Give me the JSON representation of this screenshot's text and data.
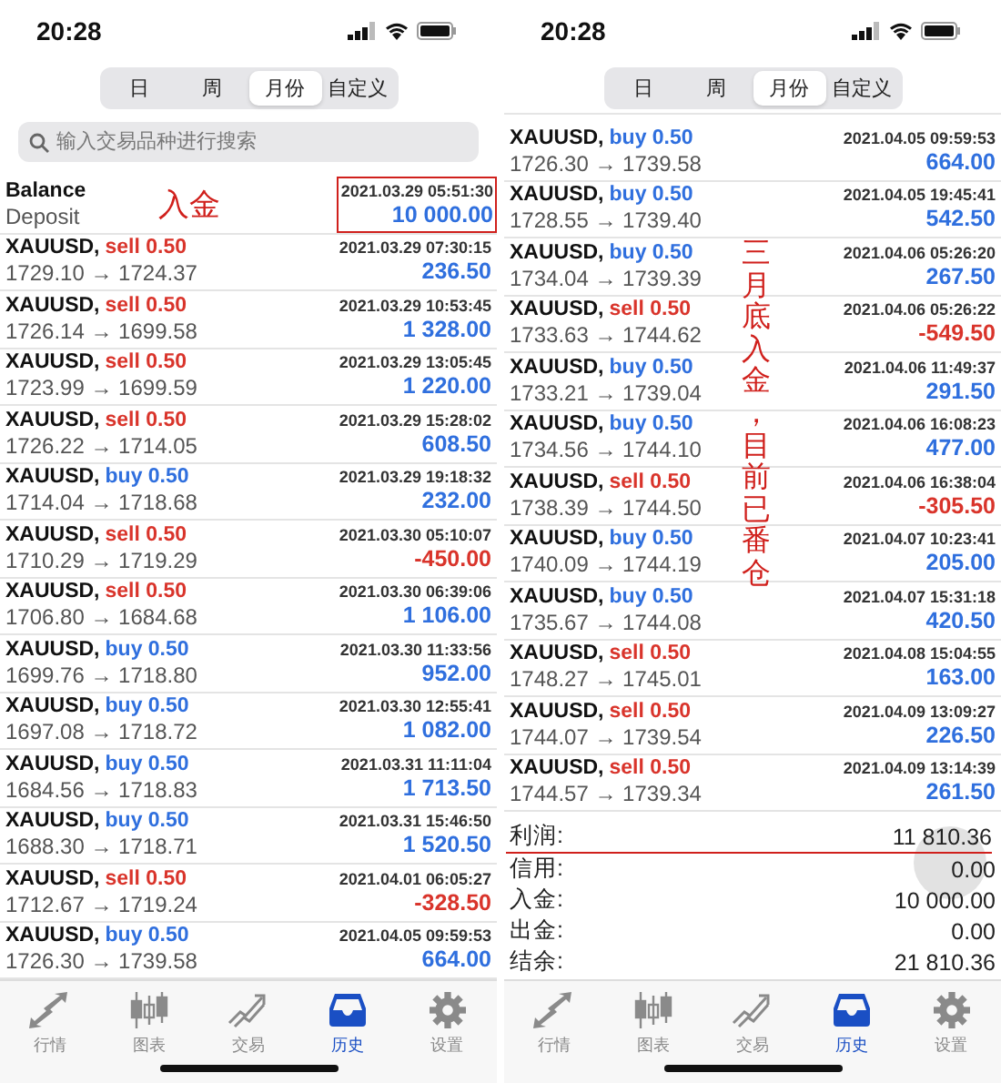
{
  "screens": [
    {
      "status_bar": {
        "time": "20:28"
      },
      "segments": [
        {
          "label": "日",
          "selected": false
        },
        {
          "label": "周",
          "selected": false
        },
        {
          "label": "月份",
          "selected": true
        },
        {
          "label": "自定义",
          "selected": false
        }
      ],
      "search": {
        "placeholder": "输入交易品种进行搜索"
      },
      "entries": [
        {
          "kind": "balance",
          "title": "Balance",
          "subtitle": "Deposit",
          "time": "2021.03.29 05:51:30",
          "amount": "10 000.00",
          "loss": false,
          "highlighted": true,
          "annotation": "入金"
        },
        {
          "kind": "trade",
          "symbol": "XAUUSD,",
          "side": "sell 0.50",
          "color": "#d9342b",
          "prices": "1729.10 → 1724.37",
          "time": "2021.03.29 07:30:15",
          "amount": "236.50",
          "loss": false
        },
        {
          "kind": "trade",
          "symbol": "XAUUSD,",
          "side": "sell 0.50",
          "color": "#d9342b",
          "prices": "1726.14 → 1699.58",
          "time": "2021.03.29 10:53:45",
          "amount": "1 328.00",
          "loss": false
        },
        {
          "kind": "trade",
          "symbol": "XAUUSD,",
          "side": "sell 0.50",
          "color": "#d9342b",
          "prices": "1723.99 → 1699.59",
          "time": "2021.03.29 13:05:45",
          "amount": "1 220.00",
          "loss": false
        },
        {
          "kind": "trade",
          "symbol": "XAUUSD,",
          "side": "sell 0.50",
          "color": "#d9342b",
          "prices": "1726.22 → 1714.05",
          "time": "2021.03.29 15:28:02",
          "amount": "608.50",
          "loss": false
        },
        {
          "kind": "trade",
          "symbol": "XAUUSD,",
          "side": "buy 0.50",
          "color": "#2f6fde",
          "prices": "1714.04 → 1718.68",
          "time": "2021.03.29 19:18:32",
          "amount": "232.00",
          "loss": false
        },
        {
          "kind": "trade",
          "symbol": "XAUUSD,",
          "side": "sell 0.50",
          "color": "#d9342b",
          "prices": "1710.29 → 1719.29",
          "time": "2021.03.30 05:10:07",
          "amount": "-450.00",
          "loss": true
        },
        {
          "kind": "trade",
          "symbol": "XAUUSD,",
          "side": "sell 0.50",
          "color": "#d9342b",
          "prices": "1706.80 → 1684.68",
          "time": "2021.03.30 06:39:06",
          "amount": "1 106.00",
          "loss": false
        },
        {
          "kind": "trade",
          "symbol": "XAUUSD,",
          "side": "buy 0.50",
          "color": "#2f6fde",
          "prices": "1699.76 → 1718.80",
          "time": "2021.03.30 11:33:56",
          "amount": "952.00",
          "loss": false
        },
        {
          "kind": "trade",
          "symbol": "XAUUSD,",
          "side": "buy 0.50",
          "color": "#2f6fde",
          "prices": "1697.08 → 1718.72",
          "time": "2021.03.30 12:55:41",
          "amount": "1 082.00",
          "loss": false
        },
        {
          "kind": "trade",
          "symbol": "XAUUSD,",
          "side": "buy 0.50",
          "color": "#2f6fde",
          "prices": "1684.56 → 1718.83",
          "time": "2021.03.31 11:11:04",
          "amount": "1 713.50",
          "loss": false
        },
        {
          "kind": "trade",
          "symbol": "XAUUSD,",
          "side": "buy 0.50",
          "color": "#2f6fde",
          "prices": "1688.30 → 1718.71",
          "time": "2021.03.31 15:46:50",
          "amount": "1 520.50",
          "loss": false
        },
        {
          "kind": "trade",
          "symbol": "XAUUSD,",
          "side": "sell 0.50",
          "color": "#d9342b",
          "prices": "1712.67 → 1719.24",
          "time": "2021.04.01 06:05:27",
          "amount": "-328.50",
          "loss": true
        },
        {
          "kind": "trade",
          "symbol": "XAUUSD,",
          "side": "buy 0.50",
          "color": "#2f6fde",
          "prices": "1726.30 → 1739.58",
          "time": "2021.04.05 09:59:53",
          "amount": "664.00",
          "loss": false
        }
      ],
      "tab_bar": [
        {
          "label": "行情",
          "selected": false
        },
        {
          "label": "图表",
          "selected": false
        },
        {
          "label": "交易",
          "selected": false
        },
        {
          "label": "历史",
          "selected": true
        },
        {
          "label": "设置",
          "selected": false
        }
      ]
    },
    {
      "status_bar": {
        "time": "20:28"
      },
      "segments": [
        {
          "label": "日",
          "selected": false
        },
        {
          "label": "周",
          "selected": false
        },
        {
          "label": "月份",
          "selected": true
        },
        {
          "label": "自定义",
          "selected": false
        }
      ],
      "entries": [
        {
          "kind": "trade",
          "symbol": "XAUUSD,",
          "side": "buy 0.50",
          "color": "#2f6fde",
          "prices": "1726.30 → 1739.58",
          "time": "2021.04.05 09:59:53",
          "amount": "664.00",
          "loss": false
        },
        {
          "kind": "trade",
          "symbol": "XAUUSD,",
          "side": "buy 0.50",
          "color": "#2f6fde",
          "prices": "1728.55 → 1739.40",
          "time": "2021.04.05 19:45:41",
          "amount": "542.50",
          "loss": false
        },
        {
          "kind": "trade",
          "symbol": "XAUUSD,",
          "side": "buy 0.50",
          "color": "#2f6fde",
          "prices": "1734.04 → 1739.39",
          "time": "2021.04.06 05:26:20",
          "amount": "267.50",
          "loss": false
        },
        {
          "kind": "trade",
          "symbol": "XAUUSD,",
          "side": "sell 0.50",
          "color": "#d9342b",
          "prices": "1733.63 → 1744.62",
          "time": "2021.04.06 05:26:22",
          "amount": "-549.50",
          "loss": true
        },
        {
          "kind": "trade",
          "symbol": "XAUUSD,",
          "side": "buy 0.50",
          "color": "#2f6fde",
          "prices": "1733.21 → 1739.04",
          "time": "2021.04.06 11:49:37",
          "amount": "291.50",
          "loss": false
        },
        {
          "kind": "trade",
          "symbol": "XAUUSD,",
          "side": "buy 0.50",
          "color": "#2f6fde",
          "prices": "1734.56 → 1744.10",
          "time": "2021.04.06 16:08:23",
          "amount": "477.00",
          "loss": false
        },
        {
          "kind": "trade",
          "symbol": "XAUUSD,",
          "side": "sell 0.50",
          "color": "#d9342b",
          "prices": "1738.39 → 1744.50",
          "time": "2021.04.06 16:38:04",
          "amount": "-305.50",
          "loss": true
        },
        {
          "kind": "trade",
          "symbol": "XAUUSD,",
          "side": "buy 0.50",
          "color": "#2f6fde",
          "prices": "1740.09 → 1744.19",
          "time": "2021.04.07 10:23:41",
          "amount": "205.00",
          "loss": false
        },
        {
          "kind": "trade",
          "symbol": "XAUUSD,",
          "side": "buy 0.50",
          "color": "#2f6fde",
          "prices": "1735.67 → 1744.08",
          "time": "2021.04.07 15:31:18",
          "amount": "420.50",
          "loss": false
        },
        {
          "kind": "trade",
          "symbol": "XAUUSD,",
          "side": "sell 0.50",
          "color": "#d9342b",
          "prices": "1748.27 → 1745.01",
          "time": "2021.04.08 15:04:55",
          "amount": "163.00",
          "loss": false
        },
        {
          "kind": "trade",
          "symbol": "XAUUSD,",
          "side": "sell 0.50",
          "color": "#d9342b",
          "prices": "1744.07 → 1739.54",
          "time": "2021.04.09 13:09:27",
          "amount": "226.50",
          "loss": false
        },
        {
          "kind": "trade",
          "symbol": "XAUUSD,",
          "side": "sell 0.50",
          "color": "#d9342b",
          "prices": "1744.57 → 1739.34",
          "time": "2021.04.09 13:14:39",
          "amount": "261.50",
          "loss": false
        }
      ],
      "note": "三月底入金，目前已番仓",
      "summary": [
        {
          "label": "利润:",
          "value": "11 810.36",
          "underlined": true
        },
        {
          "label": "信用:",
          "value": "0.00",
          "underlined": false
        },
        {
          "label": "入金:",
          "value": "10 000.00",
          "underlined": false
        },
        {
          "label": "出金:",
          "value": "0.00",
          "underlined": false
        },
        {
          "label": "结余:",
          "value": "21 810.36",
          "underlined": false
        }
      ],
      "tab_bar": [
        {
          "label": "行情",
          "selected": false
        },
        {
          "label": "图表",
          "selected": false
        },
        {
          "label": "交易",
          "selected": false
        },
        {
          "label": "历史",
          "selected": true
        },
        {
          "label": "设置",
          "selected": false
        }
      ]
    }
  ]
}
